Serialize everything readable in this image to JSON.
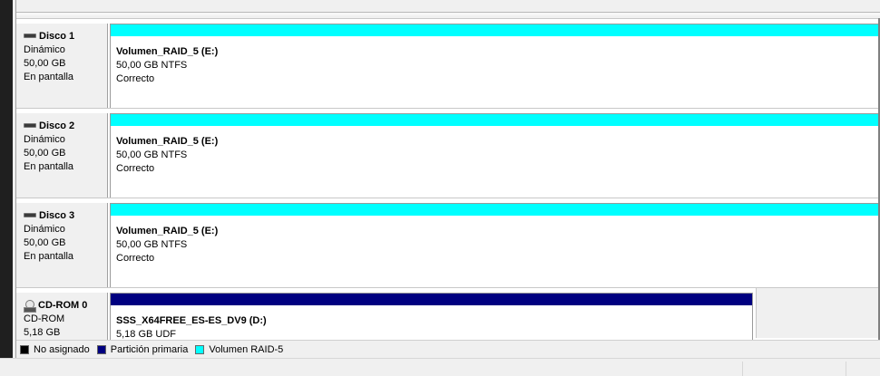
{
  "disks": [
    {
      "name": "Disco 1",
      "type": "Dinámico",
      "size": "50,00 GB",
      "status": "En pantalla",
      "icon": "hard-disk-icon",
      "volume": {
        "name": "Volumen_RAID_5  (E:)",
        "size_fs": "50,00 GB NTFS",
        "health": "Correcto",
        "bar_color": "#00ffff"
      }
    },
    {
      "name": "Disco 2",
      "type": "Dinámico",
      "size": "50,00 GB",
      "status": "En pantalla",
      "icon": "hard-disk-icon",
      "volume": {
        "name": "Volumen_RAID_5  (E:)",
        "size_fs": "50,00 GB NTFS",
        "health": "Correcto",
        "bar_color": "#00ffff"
      }
    },
    {
      "name": "Disco 3",
      "type": "Dinámico",
      "size": "50,00 GB",
      "status": "En pantalla",
      "icon": "hard-disk-icon",
      "volume": {
        "name": "Volumen_RAID_5  (E:)",
        "size_fs": "50,00 GB NTFS",
        "health": "Correcto",
        "bar_color": "#00ffff"
      }
    }
  ],
  "cdrom": {
    "name": "CD-ROM 0",
    "type": "CD-ROM",
    "size": "5,18 GB",
    "icon": "cd-rom-icon",
    "volume": {
      "name": "SSS_X64FREE_ES-ES_DV9  (D:)",
      "size_fs": "5,18 GB UDF",
      "bar_color": "#000080"
    }
  },
  "legend": [
    {
      "label": "No asignado",
      "color": "#000000"
    },
    {
      "label": "Partición primaria",
      "color": "#000080"
    },
    {
      "label": "Volumen RAID-5",
      "color": "#00ffff"
    }
  ]
}
